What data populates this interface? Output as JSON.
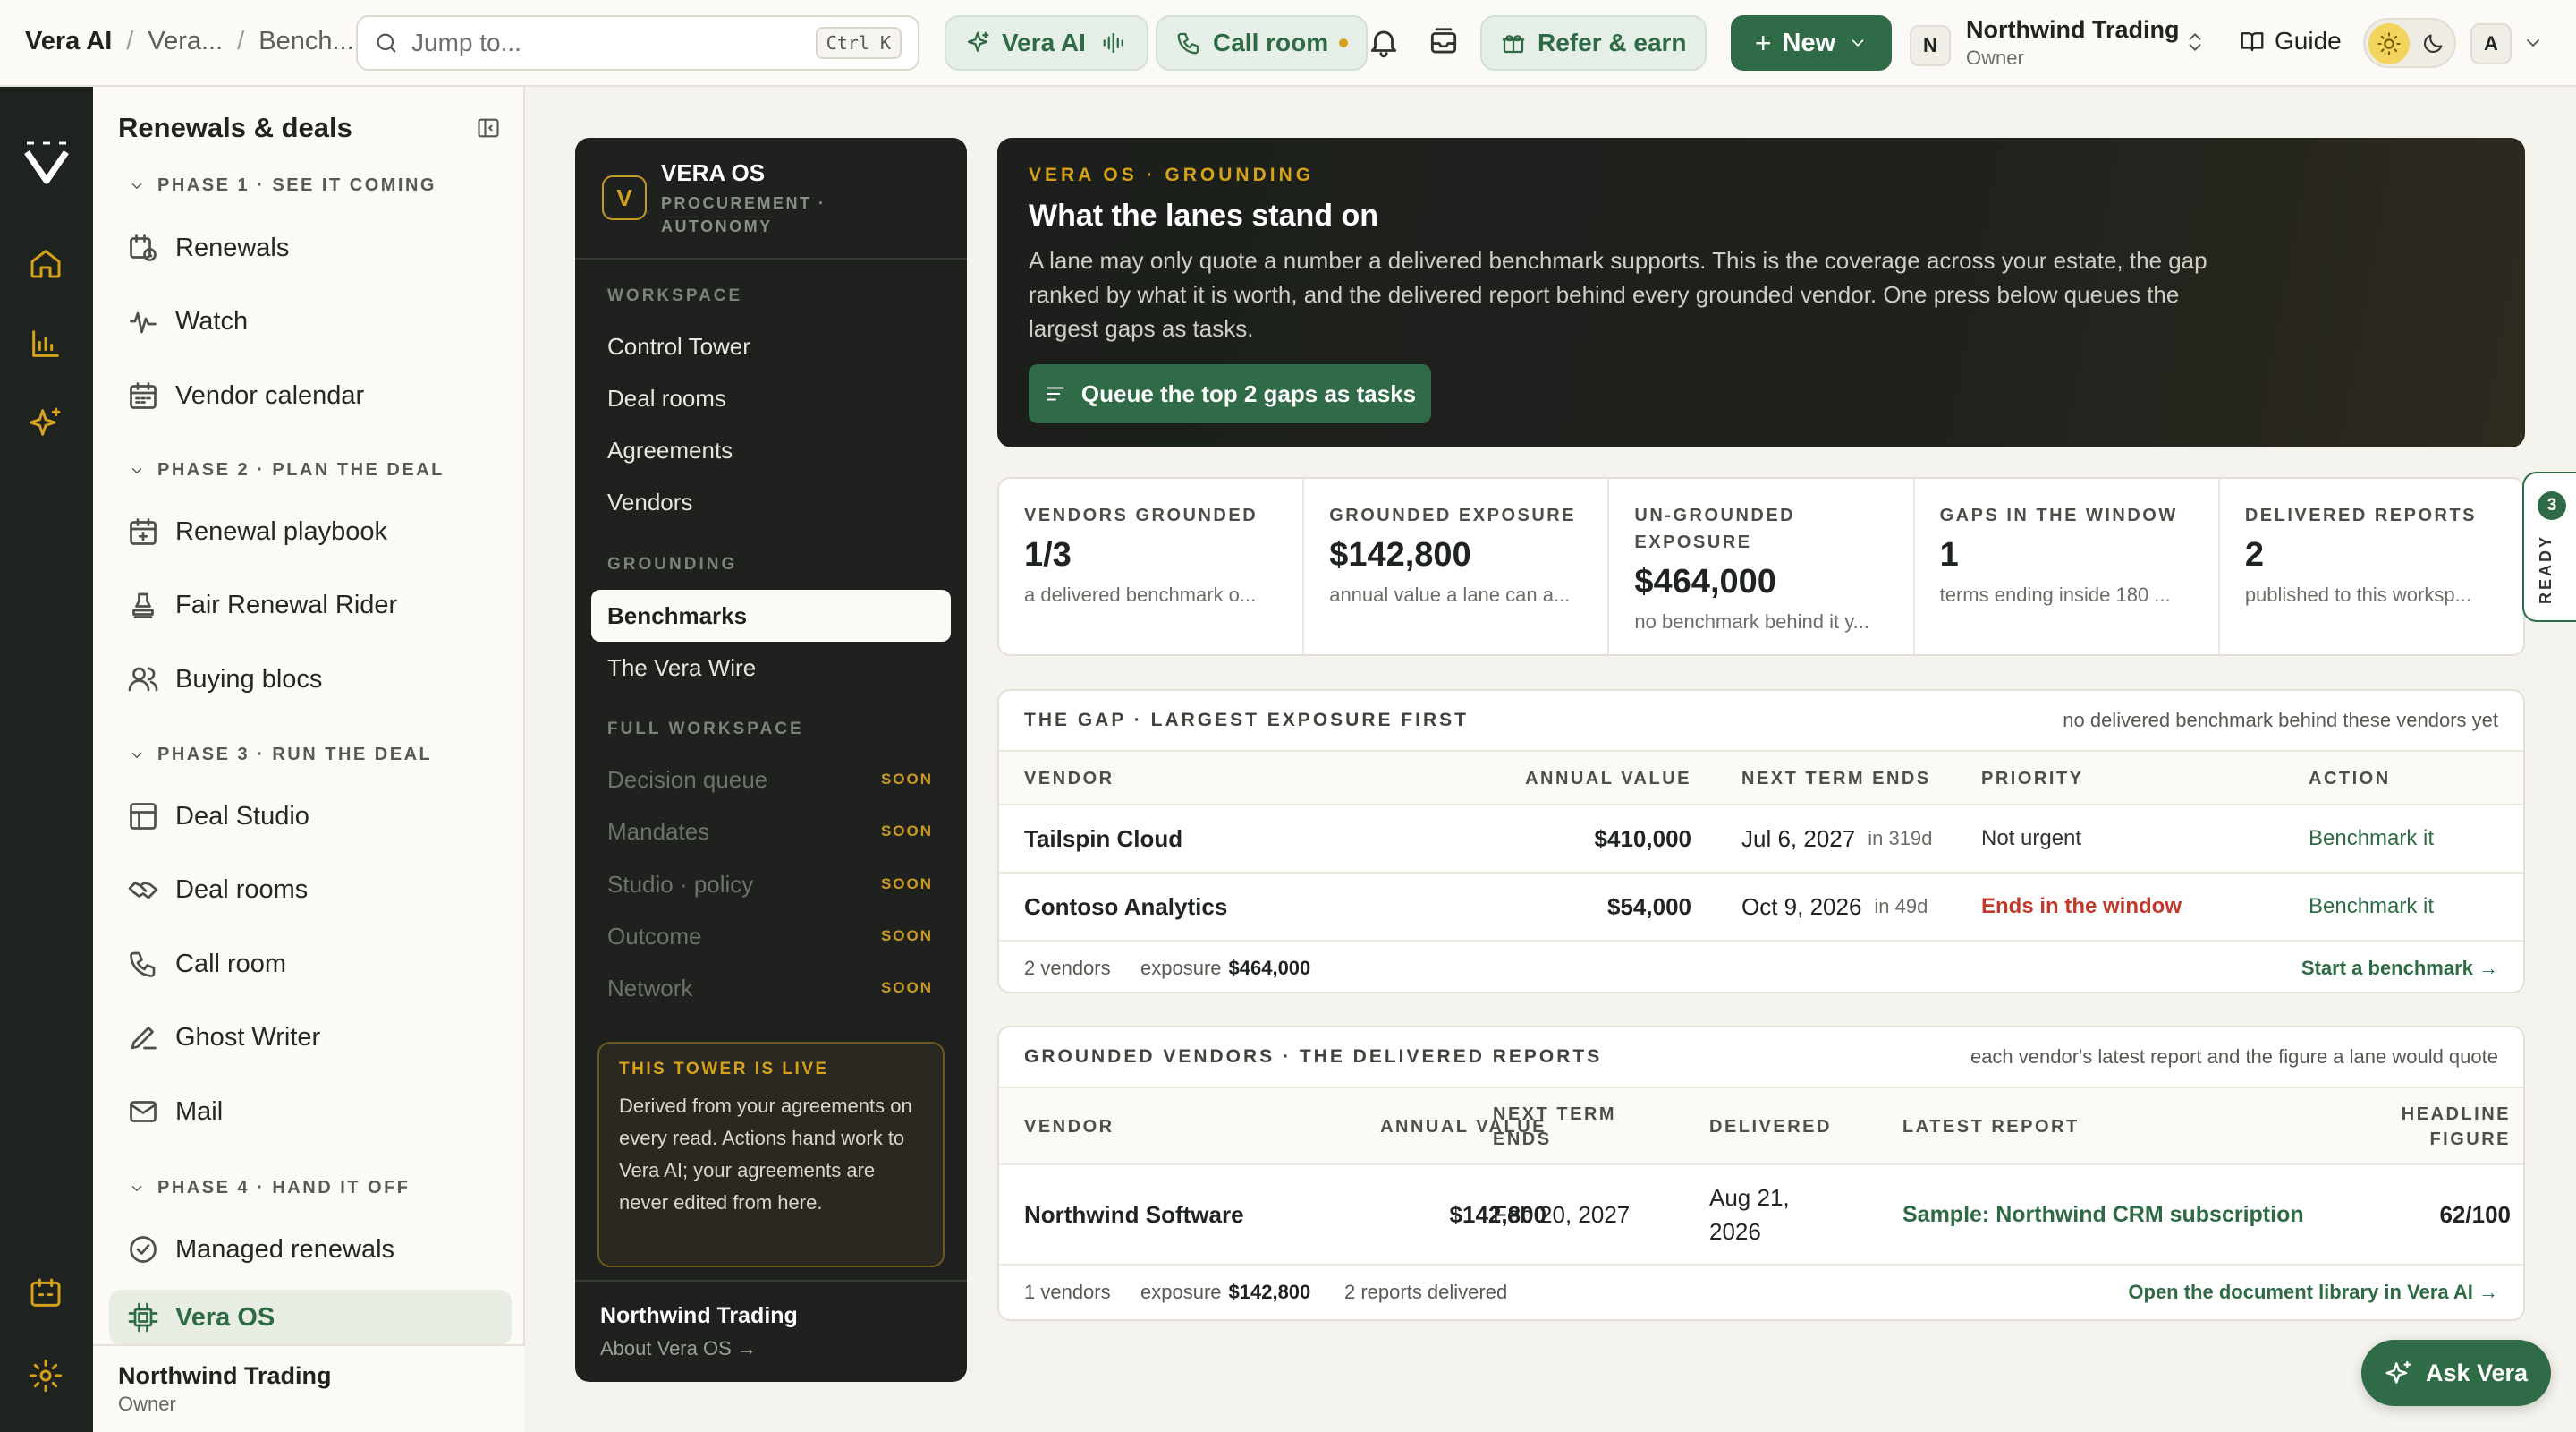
{
  "topbar": {
    "breadcrumbs": [
      "Vera AI",
      "Vera...",
      "Bench..."
    ],
    "search_placeholder": "Jump to...",
    "search_shortcut": "Ctrl K",
    "vera_ai_label": "Vera AI",
    "call_room_label": "Call room",
    "refer_label": "Refer & earn",
    "new_label": "New",
    "org_initial": "N",
    "org_name": "Northwind Trading",
    "org_role": "Owner",
    "guide_label": "Guide",
    "user_initial": "A"
  },
  "sidebar": {
    "title": "Renewals & deals",
    "phases": [
      {
        "label": "PHASE 1 · SEE IT COMING",
        "items": [
          "Renewals",
          "Watch",
          "Vendor calendar"
        ]
      },
      {
        "label": "PHASE 2 · PLAN THE DEAL",
        "items": [
          "Renewal playbook",
          "Fair Renewal Rider",
          "Buying blocs"
        ]
      },
      {
        "label": "PHASE 3 · RUN THE DEAL",
        "items": [
          "Deal Studio",
          "Deal rooms",
          "Call room",
          "Ghost Writer",
          "Mail"
        ]
      },
      {
        "label": "PHASE 4 · HAND IT OFF",
        "items": [
          "Managed renewals",
          "Vera OS"
        ]
      }
    ],
    "footer_name": "Northwind Trading",
    "footer_role": "Owner"
  },
  "vera_os": {
    "badge": "V",
    "name": "VERA OS",
    "subtitle": "PROCUREMENT · AUTONOMY",
    "workspace_label": "WORKSPACE",
    "workspace_items": [
      "Control Tower",
      "Deal rooms",
      "Agreements",
      "Vendors"
    ],
    "grounding_label": "GROUNDING",
    "grounding_items": [
      "Benchmarks",
      "The Vera Wire"
    ],
    "full_label": "FULL WORKSPACE",
    "full_items": [
      "Decision queue",
      "Mandates",
      "Studio · policy",
      "Outcome",
      "Network"
    ],
    "soon_label": "SOON",
    "live_title": "THIS TOWER IS LIVE",
    "live_body": "Derived from your agreements on every read. Actions hand work to Vera AI; your agreements are never edited from here.",
    "footer_title": "Northwind Trading",
    "footer_link": "About Vera OS →"
  },
  "hero": {
    "eyebrow": "VERA OS · GROUNDING",
    "title": "What the lanes stand on",
    "description": "A lane may only quote a number a delivered benchmark supports. This is the coverage across your estate, the gap ranked by what it is worth, and the delivered report behind every grounded vendor. One press below queues the largest gaps as tasks.",
    "button": "Queue the top 2 gaps as tasks"
  },
  "stats": [
    {
      "label": "VENDORS GROUNDED",
      "value": "1/3",
      "desc": "a delivered benchmark o..."
    },
    {
      "label": "GROUNDED EXPOSURE",
      "value": "$142,800",
      "desc": "annual value a lane can a..."
    },
    {
      "label": "UN-GROUNDED EXPOSURE",
      "value": "$464,000",
      "desc": "no benchmark behind it y..."
    },
    {
      "label": "GAPS IN THE WINDOW",
      "value": "1",
      "desc": "terms ending inside 180 ..."
    },
    {
      "label": "DELIVERED REPORTS",
      "value": "2",
      "desc": "published to this worksp..."
    }
  ],
  "ready": {
    "count": "3",
    "label": "READY"
  },
  "gap": {
    "title": "THE GAP · LARGEST EXPOSURE FIRST",
    "note": "no delivered benchmark behind these vendors yet",
    "columns": [
      "VENDOR",
      "ANNUAL VALUE",
      "NEXT TERM ENDS",
      "PRIORITY",
      "ACTION"
    ],
    "rows": [
      {
        "vendor": "Tailspin Cloud",
        "value": "$410,000",
        "ends": "Jul 6, 2027",
        "in": "in 319d",
        "priority": "Not urgent",
        "action": "Benchmark it"
      },
      {
        "vendor": "Contoso Analytics",
        "value": "$54,000",
        "ends": "Oct 9, 2026",
        "in": "in 49d",
        "priority": "Ends in the window",
        "action": "Benchmark it"
      }
    ],
    "footer_count": "2 vendors",
    "footer_exposure_label": "exposure",
    "footer_exposure": "$464,000",
    "footer_link": "Start a benchmark →"
  },
  "grounded": {
    "title": "GROUNDED VENDORS · THE DELIVERED REPORTS",
    "note": "each vendor's latest report and the figure a lane would quote",
    "columns": [
      "VENDOR",
      "ANNUAL VALUE",
      "NEXT TERM ENDS",
      "DELIVERED",
      "LATEST REPORT",
      "HEADLINE FIGURE"
    ],
    "rows": [
      {
        "vendor": "Northwind Software",
        "value": "$142,800",
        "ends": "Feb 20, 2027",
        "delivered": "Aug 21, 2026",
        "report": "Sample: Northwind CRM subscription",
        "figure": "62/100"
      }
    ],
    "footer_count": "1 vendors",
    "footer_exposure_label": "exposure",
    "footer_exposure": "$142,800",
    "footer_reports": "2 reports delivered",
    "footer_link": "Open the document library in Vera AI →"
  },
  "ask_vera": "Ask Vera",
  "colors": {
    "accent_green": "#2f6b46",
    "gold": "#d6a21a",
    "dark": "#1e211d",
    "red": "#c0392b"
  }
}
